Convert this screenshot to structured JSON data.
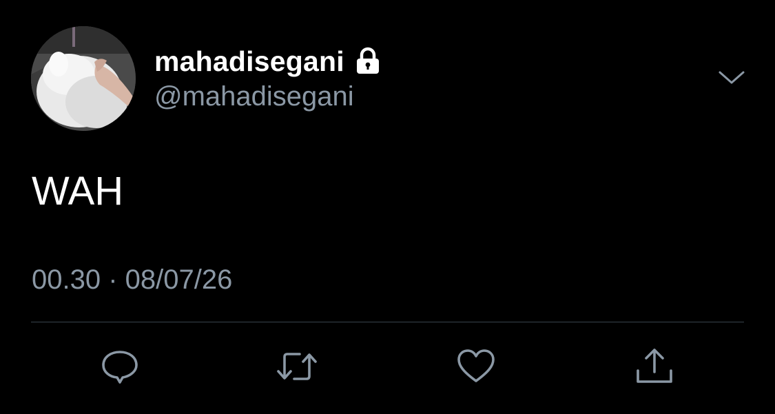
{
  "tweet": {
    "display_name": "mahadisegani",
    "handle": "@mahadisegani",
    "protected_icon": "lock-icon",
    "text": "WAH",
    "timestamp": "00.30 · 08/07/26",
    "menu_icon": "chevron-down-icon"
  },
  "actions": [
    {
      "name": "reply",
      "icon": "comment-bubble-icon"
    },
    {
      "name": "retweet",
      "icon": "retweet-arrows-icon"
    },
    {
      "name": "like",
      "icon": "heart-icon"
    },
    {
      "name": "share",
      "icon": "share-upload-icon"
    }
  ],
  "colors": {
    "background": "#000000",
    "primary_text": "#ffffff",
    "secondary_text": "#8b98a5",
    "divider": "#38444d",
    "icon": "#8b98a5"
  }
}
